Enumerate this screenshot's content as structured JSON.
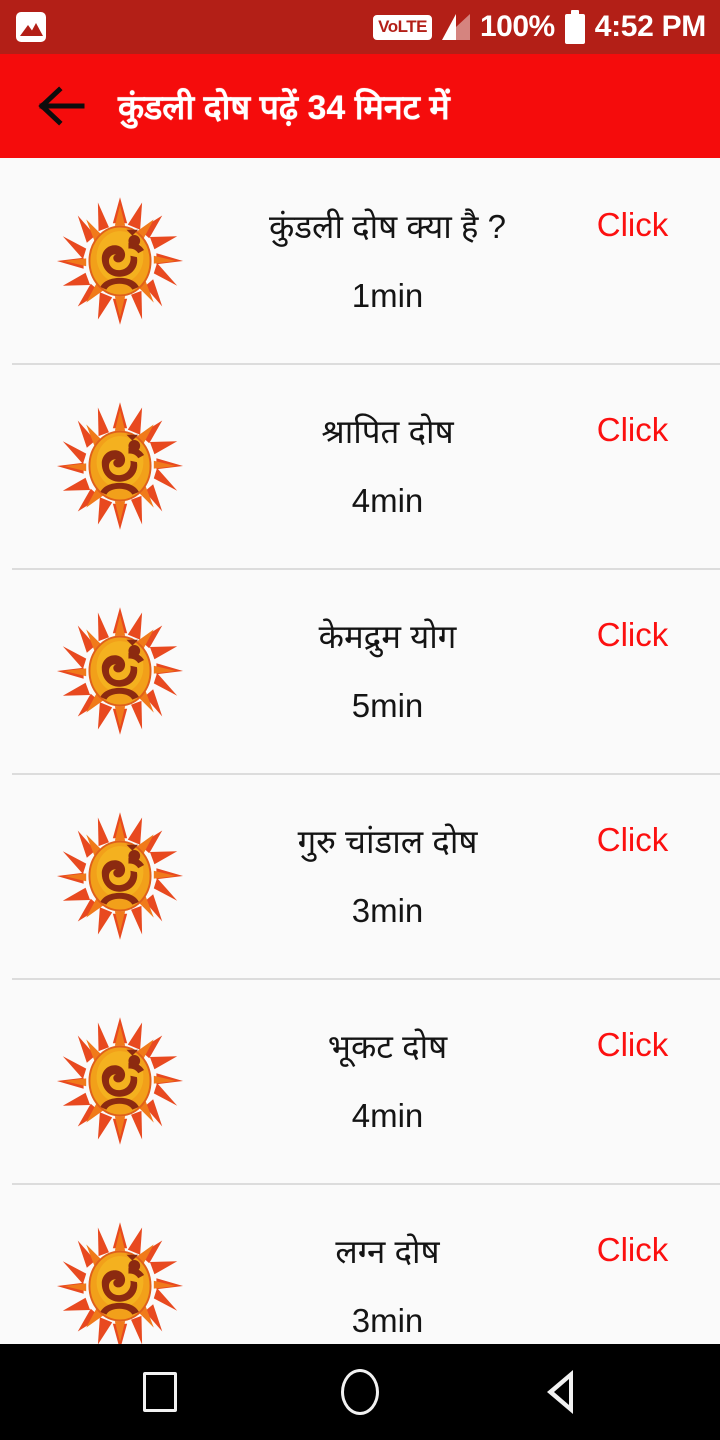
{
  "status_bar": {
    "background_color": "#b31f17",
    "left_icon": "photo-icon",
    "volte_label": "VoLTE",
    "signal_icon": "signal-bars-icon",
    "battery_percent": "100%",
    "battery_icon": "battery-icon",
    "time": "4:52 PM"
  },
  "app_bar": {
    "background_color": "#f50c0c",
    "back_icon": "back-arrow-icon",
    "title": "कुंडली दोष पढ़ें 34 मिनट में"
  },
  "list": {
    "action_label": "Click",
    "action_color": "#fc1010",
    "item_icon": "om-sun-icon",
    "items": [
      {
        "title": "कुंडली दोष क्या है ?",
        "duration": "1min",
        "action": "Click"
      },
      {
        "title": "श्रापित दोष",
        "duration": "4min",
        "action": "Click"
      },
      {
        "title": "केमद्रुम योग",
        "duration": "5min",
        "action": "Click"
      },
      {
        "title": "गुरु चांडाल दोष",
        "duration": "3min",
        "action": "Click"
      },
      {
        "title": "भूकट दोष",
        "duration": "4min",
        "action": "Click"
      },
      {
        "title": "लग्न दोष",
        "duration": "3min",
        "action": "Click"
      }
    ]
  },
  "nav_bar": {
    "background_color": "#000000",
    "recents_icon": "square-recents-icon",
    "home_icon": "circle-home-icon",
    "back_icon": "triangle-back-icon"
  }
}
